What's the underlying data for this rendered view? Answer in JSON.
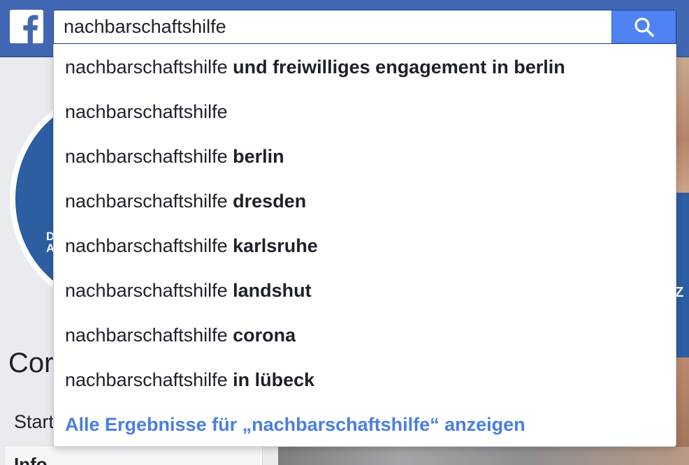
{
  "header": {
    "logo_icon": "facebook-f-icon",
    "brand_color": "#4267b2",
    "search": {
      "value": "nachbarschaftshilfe",
      "placeholder": "",
      "button_icon": "search-icon",
      "button_color": "#4f82f2"
    }
  },
  "background": {
    "profile_letters": [
      "D",
      "A"
    ],
    "page_name": "Cor",
    "nav_items": [
      "Start",
      "Info"
    ],
    "right_letter": "Z"
  },
  "dropdown": {
    "suggestions": [
      {
        "prefix": "nachbarschaftshilfe",
        "suffix": "und freiwilliges engagement in berlin"
      },
      {
        "prefix": "nachbarschaftshilfe",
        "suffix": ""
      },
      {
        "prefix": "nachbarschaftshilfe",
        "suffix": "berlin"
      },
      {
        "prefix": "nachbarschaftshilfe",
        "suffix": "dresden"
      },
      {
        "prefix": "nachbarschaftshilfe",
        "suffix": "karlsruhe"
      },
      {
        "prefix": "nachbarschaftshilfe",
        "suffix": "landshut"
      },
      {
        "prefix": "nachbarschaftshilfe",
        "suffix": "corona"
      },
      {
        "prefix": "nachbarschaftshilfe",
        "suffix": "in lübeck"
      }
    ],
    "see_all_label": "Alle Ergebnisse für „nachbarschaftshilfe“ anzeigen",
    "link_color": "#4a7ee0"
  }
}
